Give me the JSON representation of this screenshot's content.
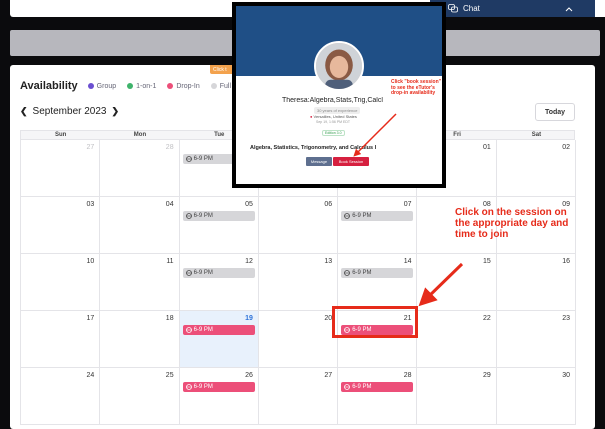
{
  "chat": {
    "label": "Chat",
    "icon": "chat-bubbles-icon"
  },
  "click_tab": {
    "label": "Click t"
  },
  "availability": {
    "title": "Availability",
    "legend": [
      {
        "label": "Group",
        "color": "#6b4fd1"
      },
      {
        "label": "1-on-1",
        "color": "#3fb36b"
      },
      {
        "label": "Drop-In",
        "color": "#ec4f79"
      },
      {
        "label": "Full / Bloc",
        "color": "#d6d6d9"
      }
    ]
  },
  "calendar": {
    "month_label": "September 2023",
    "today_label": "Today",
    "weekdays": [
      "Sun",
      "Mon",
      "Tue",
      "Wed",
      "Thu",
      "Fri",
      "Sat"
    ],
    "weeks": [
      [
        {
          "num": "27",
          "faded": true
        },
        {
          "num": "28",
          "faded": true
        },
        {
          "num": "",
          "event": "6-9 PM",
          "style": "grey"
        },
        {
          "num": ""
        },
        {
          "num": ""
        },
        {
          "num": "01"
        },
        {
          "num": "02"
        }
      ],
      [
        {
          "num": "03"
        },
        {
          "num": "04"
        },
        {
          "num": "05",
          "event": "6-9 PM",
          "style": "grey"
        },
        {
          "num": "06"
        },
        {
          "num": "07",
          "event": "6-9 PM",
          "style": "grey"
        },
        {
          "num": "08"
        },
        {
          "num": "09"
        }
      ],
      [
        {
          "num": "10"
        },
        {
          "num": "11"
        },
        {
          "num": "12",
          "event": "6-9 PM",
          "style": "grey"
        },
        {
          "num": "13"
        },
        {
          "num": "14",
          "event": "6-9 PM",
          "style": "grey"
        },
        {
          "num": "15"
        },
        {
          "num": "16"
        }
      ],
      [
        {
          "num": "17"
        },
        {
          "num": "18"
        },
        {
          "num": "19",
          "event": "6-9 PM",
          "style": "pink",
          "today": true
        },
        {
          "num": "20"
        },
        {
          "num": "21",
          "event": "6-9 PM",
          "style": "pink"
        },
        {
          "num": "22"
        },
        {
          "num": "23"
        }
      ],
      [
        {
          "num": "24"
        },
        {
          "num": "25"
        },
        {
          "num": "26",
          "event": "6-9 PM",
          "style": "pink"
        },
        {
          "num": "27"
        },
        {
          "num": "28",
          "event": "6-9 PM",
          "style": "pink"
        },
        {
          "num": "29"
        },
        {
          "num": "30"
        }
      ]
    ]
  },
  "tutor": {
    "name": "Theresa:Algebra,Stats,Trig,Calcl",
    "experience": "30 years of experience",
    "location": "Versailles, United States",
    "joined": "Sep 19, 1:56 PM EDT",
    "edition": "Edition 3.0",
    "subjects": "Algebra, Statistics, Trigonometry, and Calculus I",
    "message_label": "Message",
    "book_label": "Book Session"
  },
  "annotations": {
    "book_hint": "Click \"book session\" to see the eTutor's drop-in availability",
    "session_hint": "Click on the session on the appropriate day and time to join",
    "color": "#e62b1a"
  }
}
